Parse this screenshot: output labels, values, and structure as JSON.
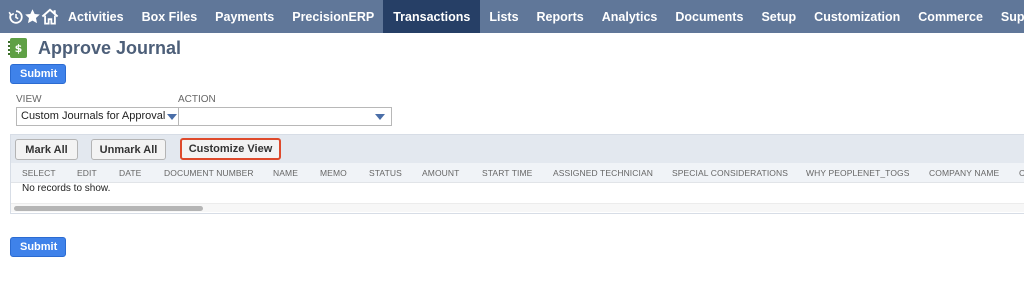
{
  "nav": {
    "icons": [
      "recent-records-icon",
      "favorites-star-icon",
      "home-icon"
    ],
    "items": [
      "Activities",
      "Box Files",
      "Payments",
      "PrecisionERP",
      "Transactions",
      "Lists",
      "Reports",
      "Analytics",
      "Documents",
      "Setup",
      "Customization",
      "Commerce",
      "Support"
    ],
    "active": "Transactions"
  },
  "page": {
    "icon": "journal-dollar-icon",
    "icon_glyph": "$",
    "title": "Approve Journal"
  },
  "buttons": {
    "submit_top": "Submit",
    "submit_bottom": "Submit"
  },
  "filters": {
    "view": {
      "label": "VIEW",
      "value": "Custom Journals for Approval"
    },
    "action": {
      "label": "ACTION",
      "value": ""
    }
  },
  "grid": {
    "mark_all": "Mark All",
    "unmark_all": "Unmark All",
    "customize_view": "Customize View",
    "columns": [
      "SELECT",
      "EDIT",
      "DATE",
      "DOCUMENT NUMBER",
      "NAME",
      "MEMO",
      "STATUS",
      "AMOUNT",
      "START TIME",
      "ASSIGNED TECHNICIAN",
      "SPECIAL CONSIDERATIONS",
      "WHY PEOPLENET_TOGS",
      "COMPANY NAME",
      "C"
    ],
    "empty_message": "No records to show."
  },
  "colors": {
    "nav_bg": "#607799",
    "nav_active": "#263f66",
    "primary_button": "#3f82ea",
    "title_text": "#4d5f79",
    "highlight_border": "#de4a2c"
  }
}
